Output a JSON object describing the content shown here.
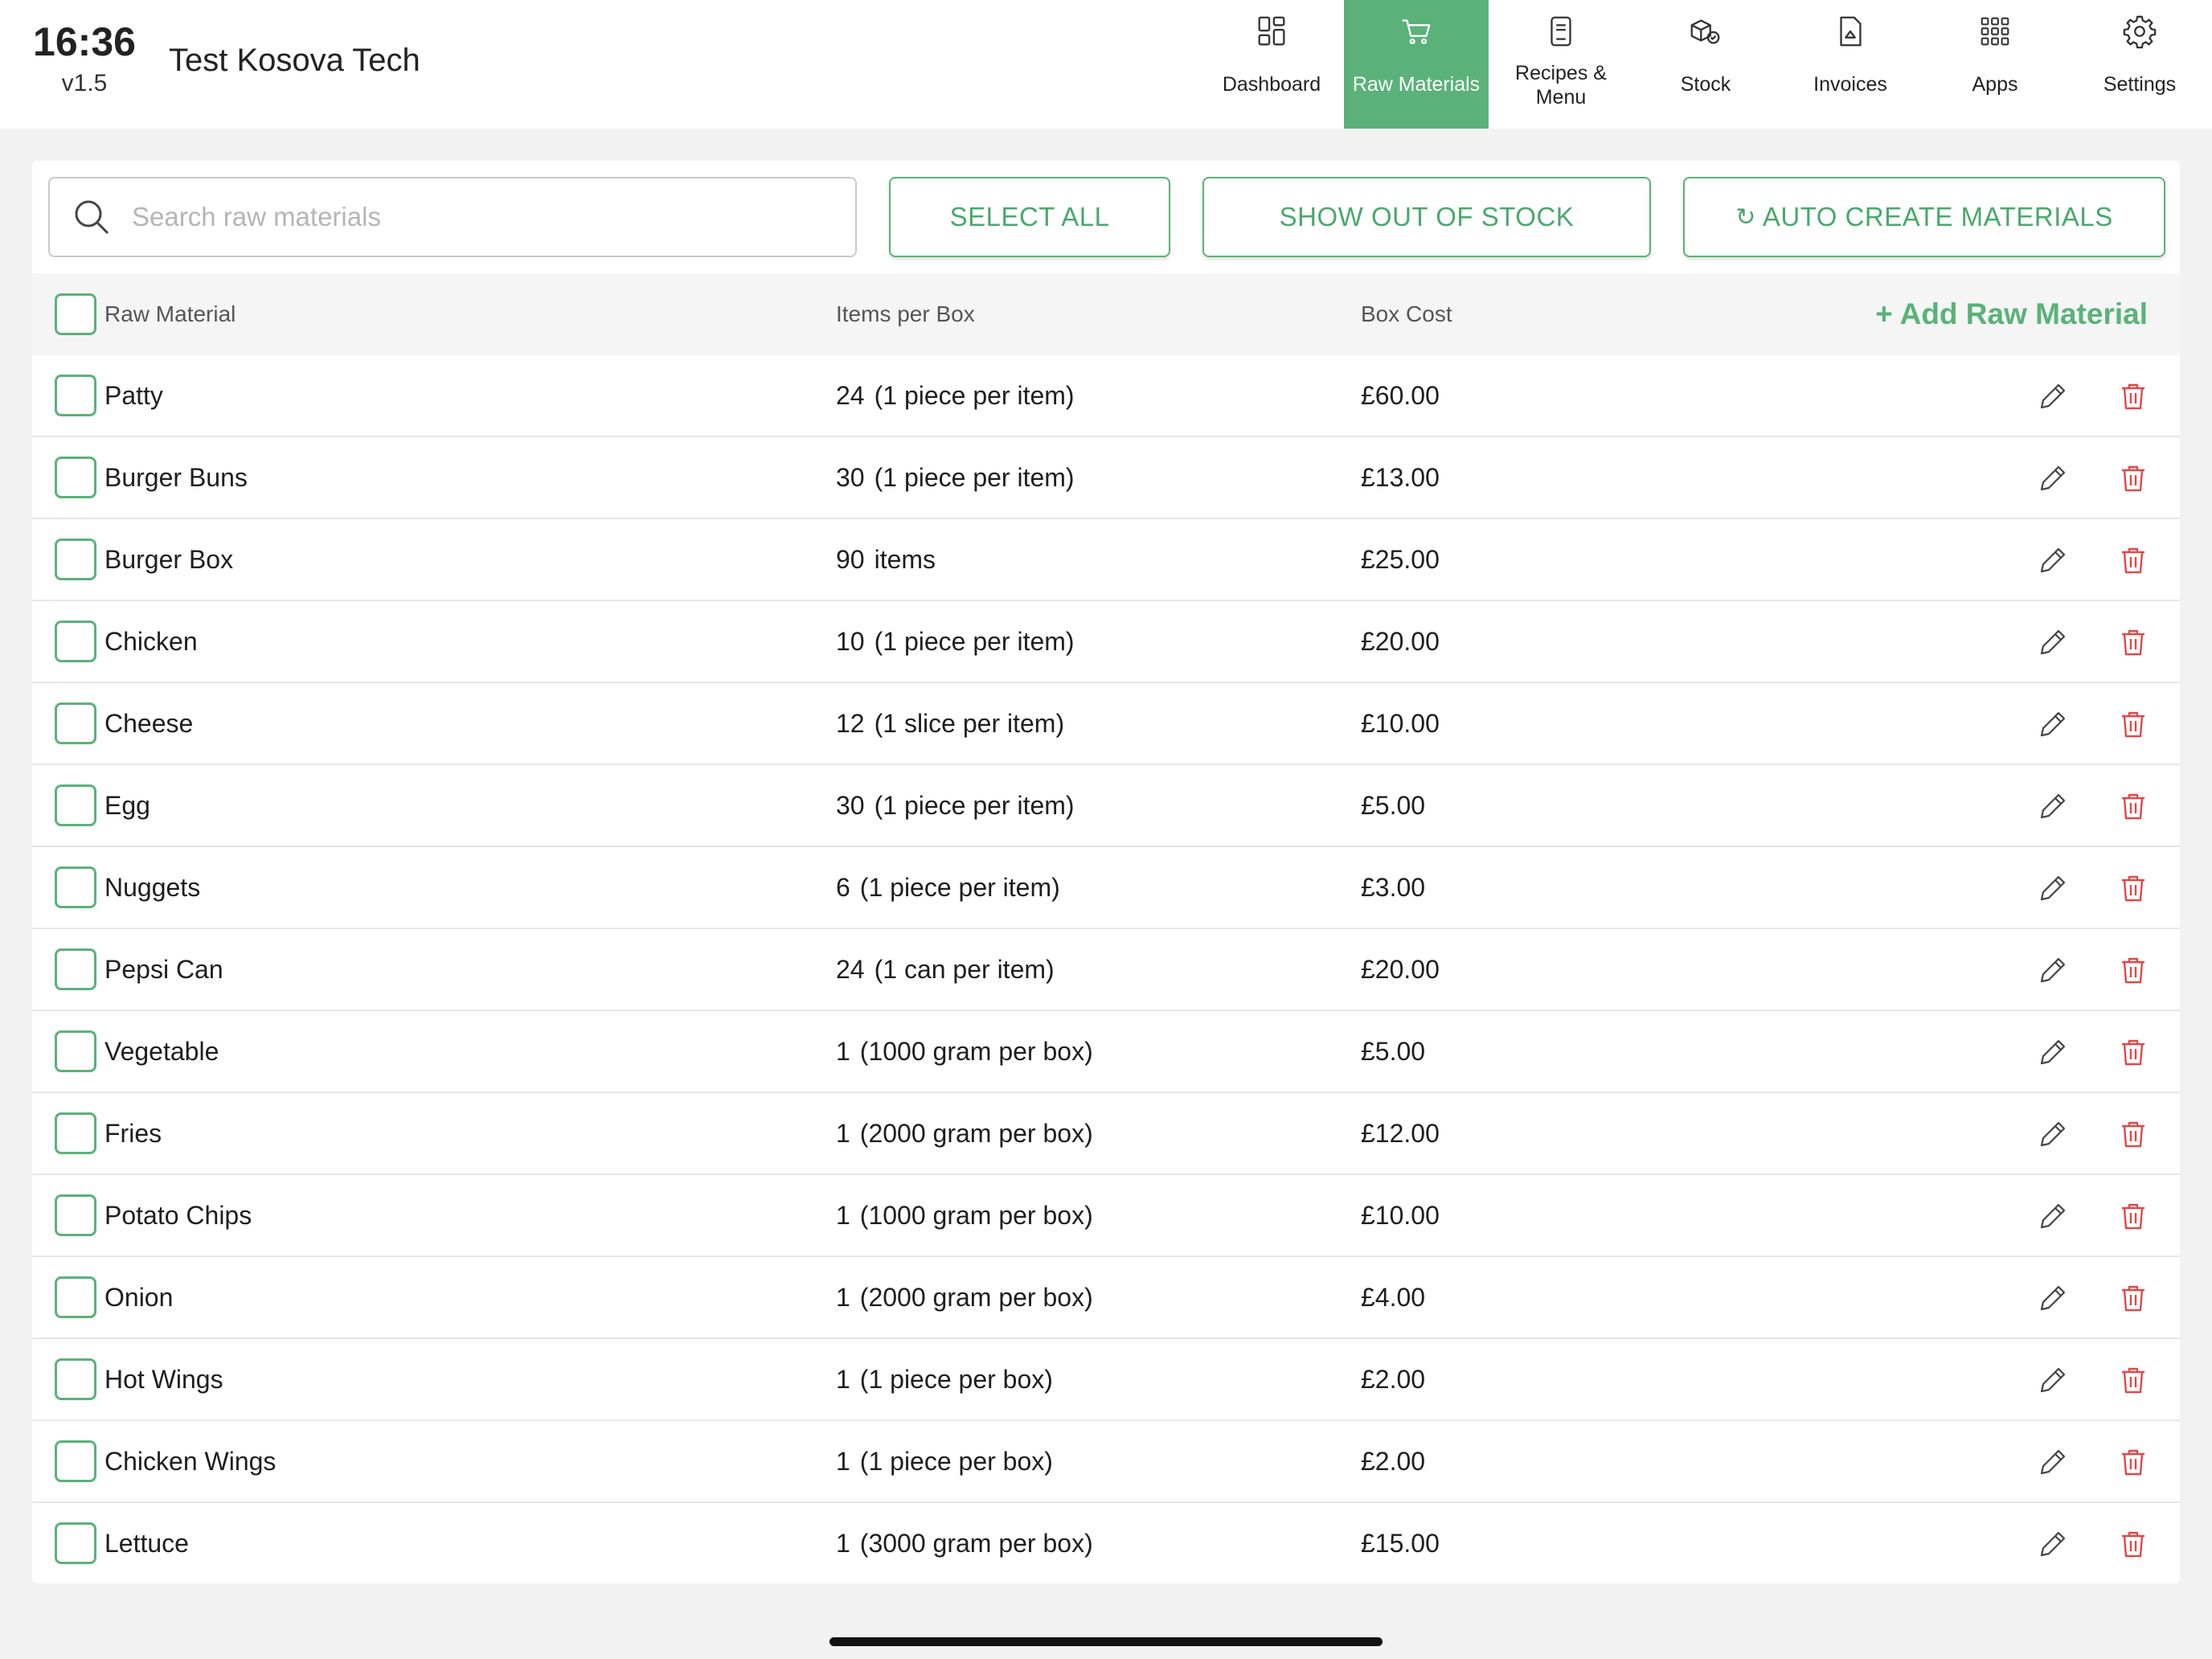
{
  "status": {
    "time": "16:36",
    "version": "v1.5"
  },
  "business": {
    "name": "Test Kosova Tech"
  },
  "nav": {
    "items": [
      {
        "label": "Dashboard",
        "icon": "dashboard-icon"
      },
      {
        "label": "Raw Materials",
        "icon": "cart-icon",
        "active": true
      },
      {
        "label": "Recipes & Menu",
        "icon": "recipe-icon"
      },
      {
        "label": "Stock",
        "icon": "stock-boxes-icon"
      },
      {
        "label": "Invoices",
        "icon": "invoice-icon"
      },
      {
        "label": "Apps",
        "icon": "apps-grid-icon"
      },
      {
        "label": "Settings",
        "icon": "gear-icon"
      }
    ]
  },
  "toolbar": {
    "search_placeholder": "Search raw materials",
    "search_value": "",
    "select_all_label": "SELECT ALL",
    "show_out_of_stock_label": "SHOW OUT OF STOCK",
    "auto_create_label": "AUTO CREATE MATERIALS"
  },
  "table": {
    "headers": {
      "name": "Raw Material",
      "qty": "Items per Box",
      "cost": "Box Cost"
    },
    "add_label": "+ Add Raw Material",
    "rows": [
      {
        "name": "Patty",
        "qty": "24",
        "unit": "(1 piece per item)",
        "cost": "£60.00"
      },
      {
        "name": "Burger Buns",
        "qty": "30",
        "unit": "(1 piece per item)",
        "cost": "£13.00"
      },
      {
        "name": "Burger Box",
        "qty": "90",
        "unit": "items",
        "cost": "£25.00"
      },
      {
        "name": "Chicken",
        "qty": "10",
        "unit": "(1 piece per item)",
        "cost": "£20.00"
      },
      {
        "name": "Cheese",
        "qty": "12",
        "unit": "(1 slice per item)",
        "cost": "£10.00"
      },
      {
        "name": "Egg",
        "qty": "30",
        "unit": "(1 piece per item)",
        "cost": "£5.00"
      },
      {
        "name": "Nuggets",
        "qty": "6",
        "unit": "(1 piece per item)",
        "cost": "£3.00"
      },
      {
        "name": "Pepsi Can",
        "qty": "24",
        "unit": "(1 can per item)",
        "cost": "£20.00"
      },
      {
        "name": "Vegetable",
        "qty": "1",
        "unit": "(1000 gram per box)",
        "cost": "£5.00"
      },
      {
        "name": "Fries",
        "qty": "1",
        "unit": "(2000 gram per box)",
        "cost": "£12.00"
      },
      {
        "name": "Potato Chips",
        "qty": "1",
        "unit": "(1000 gram per box)",
        "cost": "£10.00"
      },
      {
        "name": "Onion",
        "qty": "1",
        "unit": "(2000 gram per box)",
        "cost": "£4.00"
      },
      {
        "name": "Hot Wings",
        "qty": "1",
        "unit": "(1 piece per box)",
        "cost": "£2.00"
      },
      {
        "name": "Chicken Wings",
        "qty": "1",
        "unit": "(1 piece per box)",
        "cost": "£2.00"
      },
      {
        "name": "Lettuce",
        "qty": "1",
        "unit": "(3000 gram per box)",
        "cost": "£15.00"
      }
    ]
  },
  "colors": {
    "accent": "#5ab279",
    "delete": "#e04848",
    "background": "#f2f2f2"
  }
}
